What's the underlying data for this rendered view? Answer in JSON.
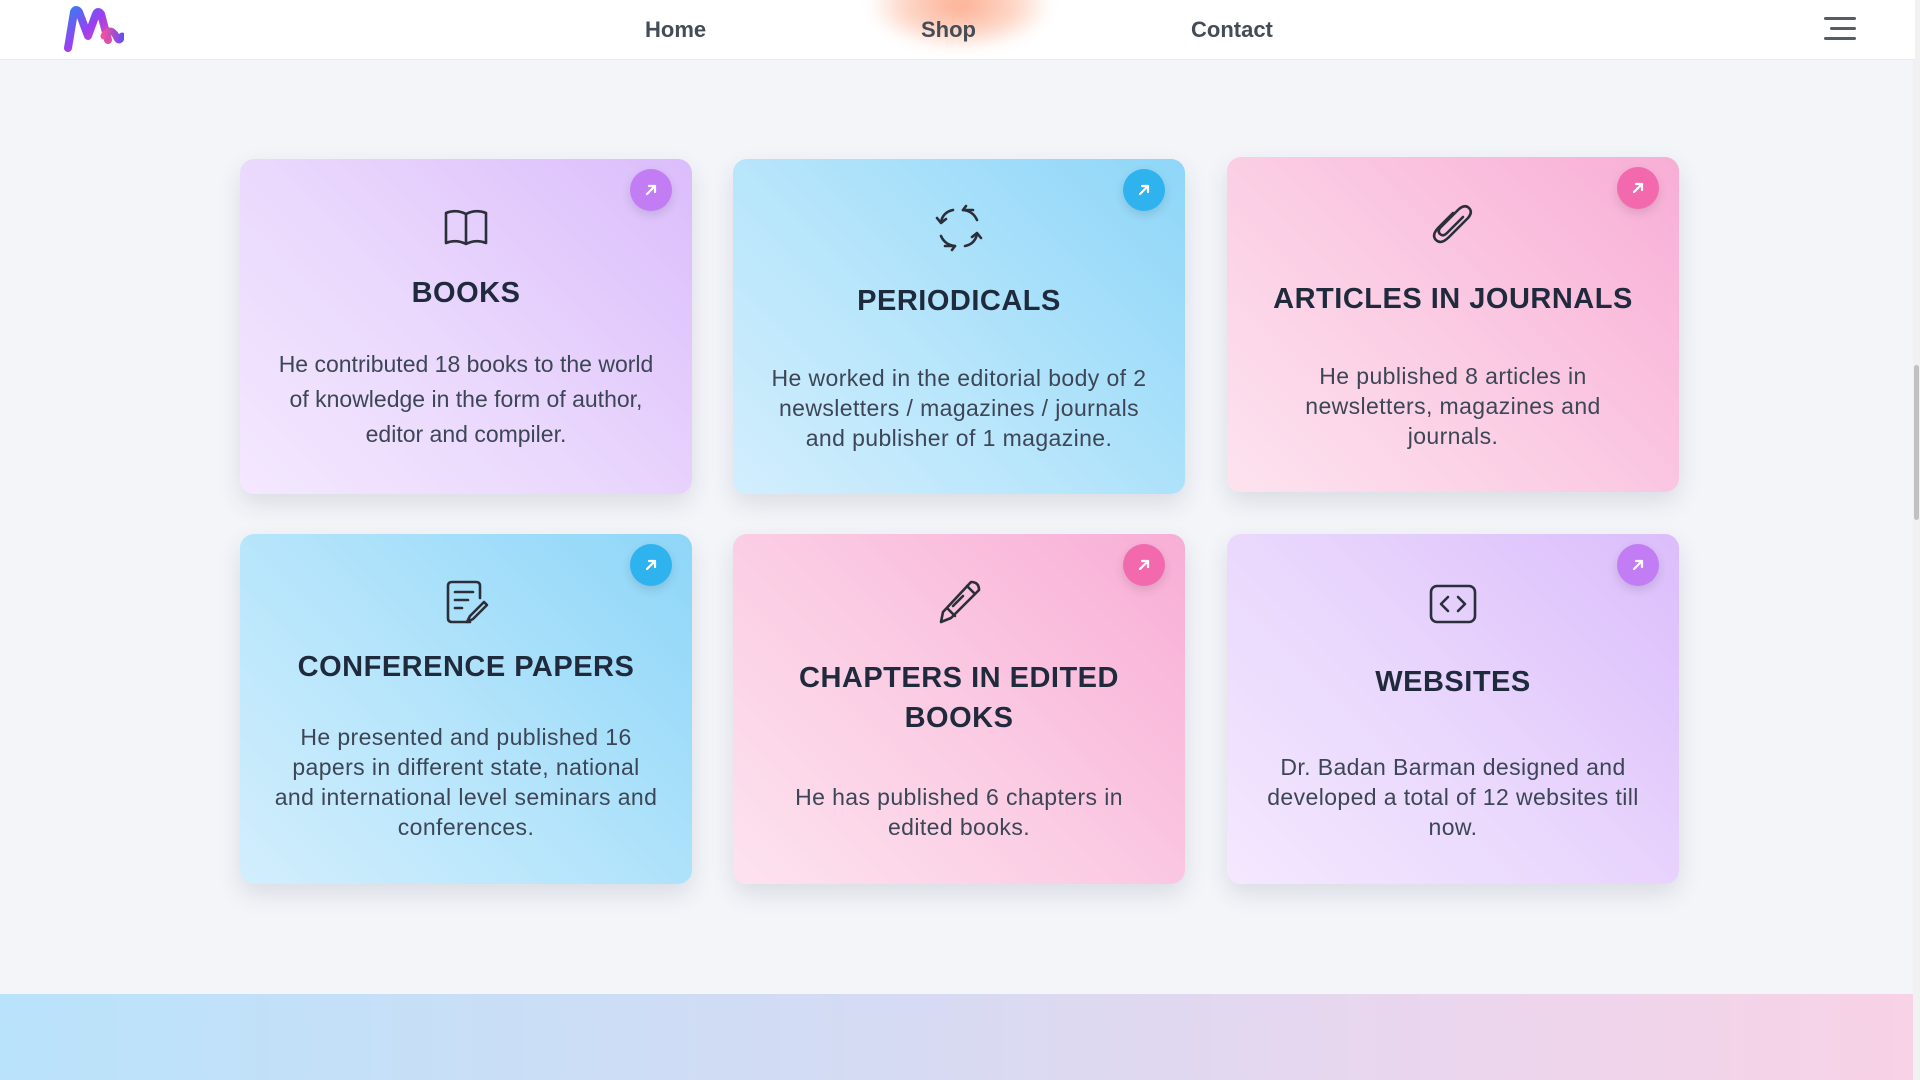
{
  "header": {
    "logo_name": "brand-logo",
    "nav": [
      {
        "label": "Home"
      },
      {
        "label": "Shop"
      },
      {
        "label": "Contact"
      }
    ],
    "menu_icon": "hamburger-menu-icon"
  },
  "cards": [
    {
      "title": "BOOKS",
      "description": "He contributed 18 books to the world of knowledge in the form of author, editor and compiler.",
      "icon": "book-open-icon",
      "color": "#dbbdfb"
    },
    {
      "title": "PERIODICALS",
      "description": "He worked in the editorial body of 2 newsletters / magazines / journals and publisher of 1 magazine.",
      "icon": "refresh-arrows-icon",
      "color": "#8ed6f8"
    },
    {
      "title": "ARTICLES IN JOURNALS",
      "description": "He published 8 articles in newsletters, magazines and journals.",
      "icon": "paperclip-icon",
      "color": "#f8aed6"
    },
    {
      "title": "CONFERENCE PAPERS",
      "description": "He presented and published 16 papers in different state, national and international level seminars and conferences.",
      "icon": "document-edit-icon",
      "color": "#8ed6f8"
    },
    {
      "title": "CHAPTERS IN EDITED BOOKS",
      "description": "He has published 6 chapters in edited books.",
      "icon": "pen-icon",
      "color": "#f8aed6"
    },
    {
      "title": "WEBSITES",
      "description": "Dr. Badan Barman designed and developed a total of 12 websites till now.",
      "icon": "code-icon",
      "color": "#dbbdfb"
    }
  ]
}
